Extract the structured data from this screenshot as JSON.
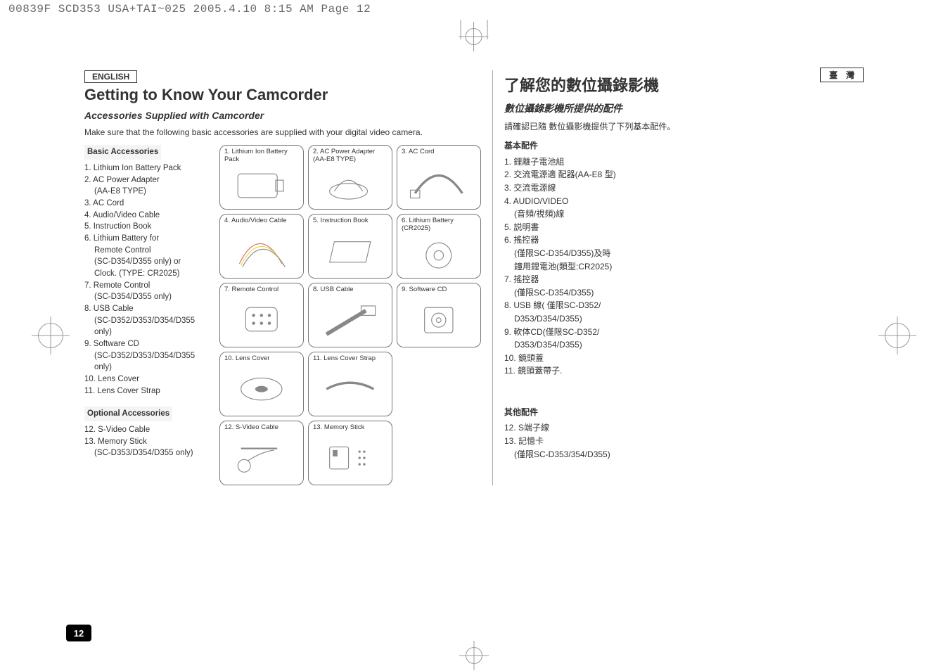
{
  "imposition": "00839F SCD353 USA+TAI~025  2005.4.10  8:15 AM  Page 12",
  "page_number": "12",
  "left": {
    "lang_label": "ENGLISH",
    "title": "Getting to Know Your Camcorder",
    "subtitle": "Accessories Supplied with Camcorder",
    "lead": "Make sure that the following basic accessories are supplied with your digital video camera.",
    "basic_heading": "Basic Accessories",
    "basic_items": [
      "1. Lithium Ion Battery Pack",
      "2. AC Power Adapter",
      "    (AA-E8 TYPE)",
      "3. AC Cord",
      "4. Audio/Video Cable",
      "5. Instruction Book",
      "6. Lithium Battery for",
      "    Remote Control",
      "    (SC-D354/D355 only) or",
      "    Clock. (TYPE: CR2025)",
      "7. Remote Control",
      "    (SC-D354/D355 only)",
      "8. USB Cable",
      "    (SC-D352/D353/D354/D355",
      "    only)",
      "9. Software CD",
      "    (SC-D352/D353/D354/D355",
      "    only)",
      "10. Lens Cover",
      "11. Lens Cover Strap"
    ],
    "optional_heading": "Optional Accessories",
    "optional_items": [
      "12. S-Video Cable",
      "13. Memory Stick",
      "    (SC-D353/D354/D355 only)"
    ]
  },
  "thumbs": [
    {
      "cap": "1. Lithium Ion Battery Pack"
    },
    {
      "cap": "2. AC Power Adapter\n(AA-E8 TYPE)"
    },
    {
      "cap": "3. AC Cord"
    },
    {
      "cap": "4. Audio/Video Cable"
    },
    {
      "cap": "5. Instruction Book"
    },
    {
      "cap": "6. Lithium Battery\n(CR2025)"
    },
    {
      "cap": "7. Remote Control"
    },
    {
      "cap": "8. USB Cable"
    },
    {
      "cap": "9. Software CD"
    },
    {
      "cap": "10. Lens Cover"
    },
    {
      "cap": "11. Lens Cover Strap"
    },
    {
      "cap": ""
    },
    {
      "cap": "12. S-Video Cable"
    },
    {
      "cap": "13. Memory Stick"
    }
  ],
  "right": {
    "lang_label": "臺灣",
    "title": "了解您的數位攝錄影機",
    "subtitle": "數位攝錄影機所提供的配件",
    "lead": "請確認已隨 數位攝影機提供了下列基本配件。",
    "basic_heading": "基本配件",
    "basic_items": [
      "1.  鋰離子電池組",
      "2.  交流電源適 配器(AA-E8 型)",
      "3.  交流電源線",
      "4.  AUDIO/VIDEO",
      "    (音頻/視頻)線",
      "5.  説明書",
      "6.  搖控器",
      "    (僅限SC-D354/D355)及時",
      "    鐘用鋰電池(類型:CR2025)",
      "7.  搖控器",
      "    (僅限SC-D354/D355)",
      "8.  USB 線( 僅限SC-D352/",
      "    D353/D354/D355)",
      "9.  軟体CD(僅限SC-D352/",
      "    D353/D354/D355)",
      "10. 鏡頭蓋",
      "11. 鏡頭蓋帶子."
    ],
    "optional_heading": "其他配件",
    "optional_items": [
      "12. S端子線",
      "13. 記憶卡",
      "    (僅限SC-D353/354/D355)"
    ]
  }
}
